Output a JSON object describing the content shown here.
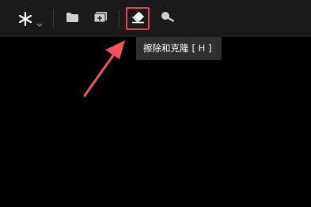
{
  "toolbar": {
    "tools": [
      {
        "name": "sparkle-icon",
        "kind": "menu"
      },
      {
        "name": "folder-icon"
      },
      {
        "name": "add-image-icon"
      },
      {
        "name": "eraser-icon",
        "active": true
      },
      {
        "name": "search-icon"
      }
    ]
  },
  "tooltip": {
    "label": "擦除和克隆",
    "shortcut": "[ H ]"
  },
  "colors": {
    "toolbar_bg": "#1a1a1a",
    "canvas_bg": "#000000",
    "highlight": "#e0474c",
    "arrow": "#f2545b",
    "tooltip_bg": "#2f2f2f"
  }
}
